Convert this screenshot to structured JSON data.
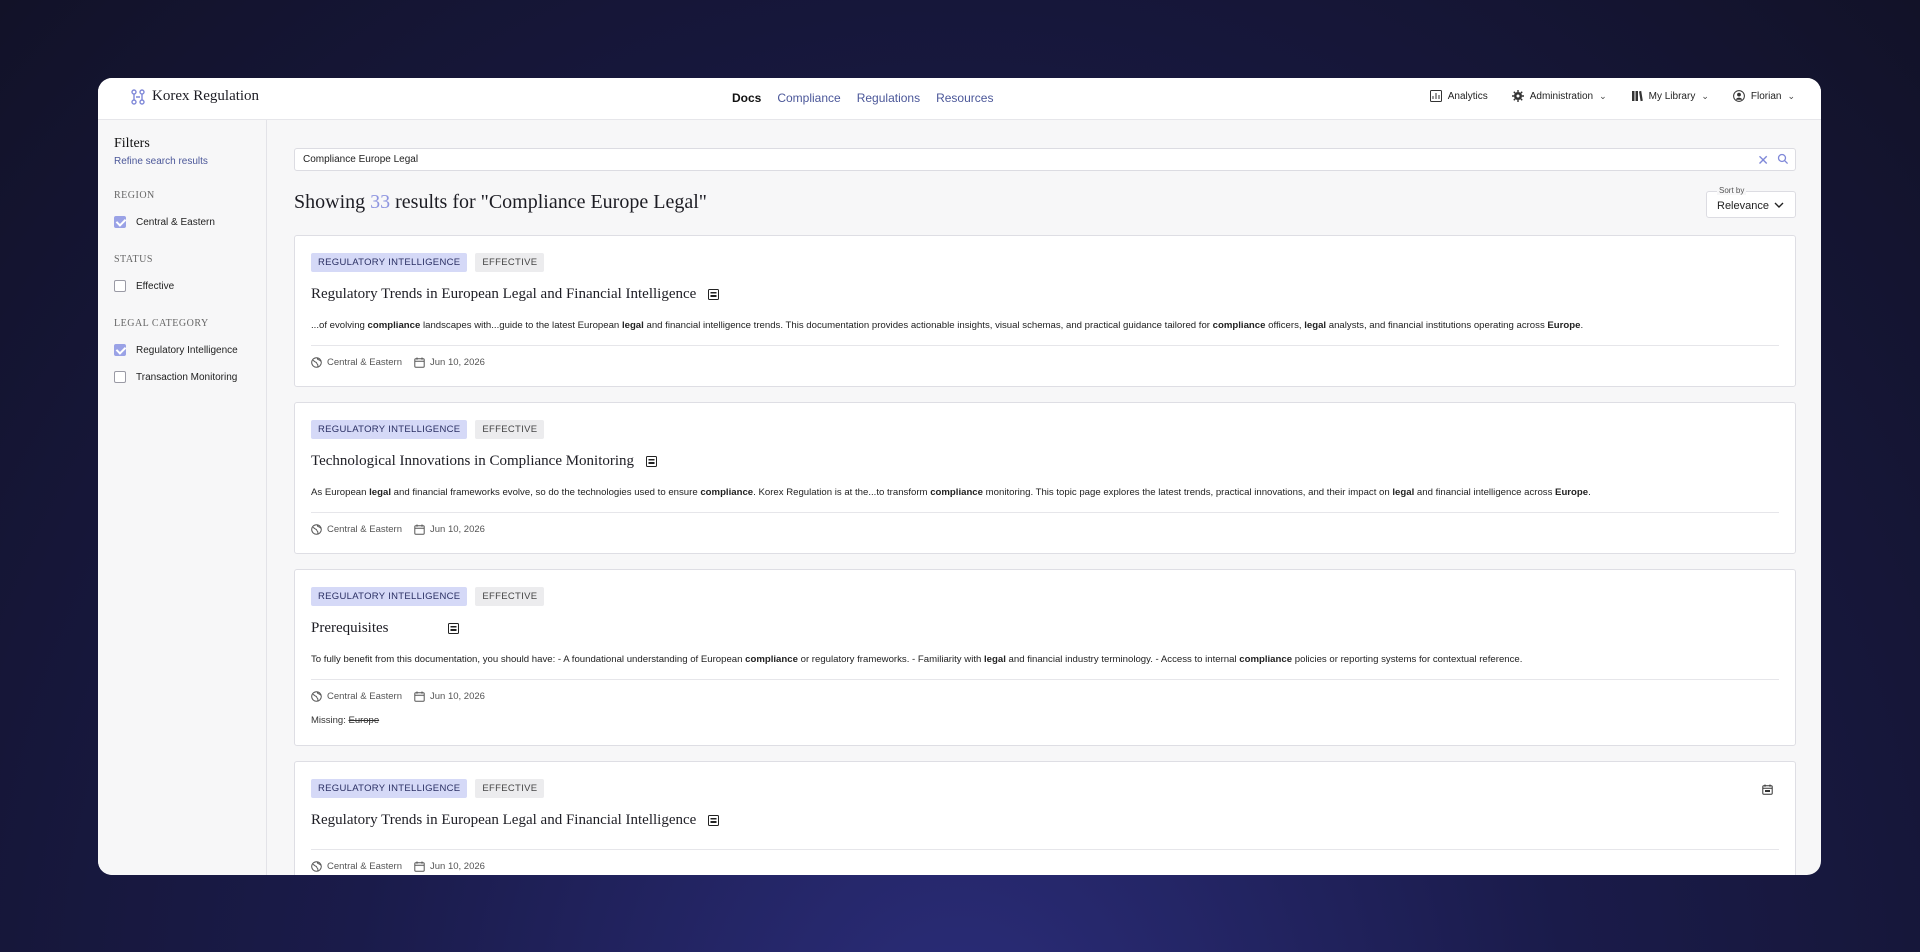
{
  "brand": {
    "name": "Korex Regulation"
  },
  "nav": {
    "links": [
      "Docs",
      "Compliance",
      "Regulations",
      "Resources"
    ],
    "right": {
      "analytics": "Analytics",
      "administration": "Administration",
      "library": "My Library",
      "user": "Florian"
    }
  },
  "sidebar": {
    "title": "Filters",
    "subtitle": "Refine search results",
    "groups": [
      {
        "label": "REGION",
        "options": [
          {
            "label": "Central & Eastern",
            "checked": true
          }
        ]
      },
      {
        "label": "STATUS",
        "options": [
          {
            "label": "Effective",
            "checked": false
          }
        ]
      },
      {
        "label": "LEGAL CATEGORY",
        "options": [
          {
            "label": "Regulatory Intelligence",
            "checked": true
          },
          {
            "label": "Transaction Monitoring",
            "checked": false
          }
        ]
      }
    ]
  },
  "search": {
    "value": "Compliance Europe Legal"
  },
  "results": {
    "prefix": "Showing",
    "count": "33",
    "suffix": "results for \"Compliance Europe Legal\""
  },
  "sort": {
    "label": "Sort by",
    "value": "Relevance"
  },
  "cards": [
    {
      "tag1": "REGULATORY INTELLIGENCE",
      "tag2": "EFFECTIVE",
      "title": "Regulatory Trends in European Legal and Financial Intelligence",
      "region": "Central & Eastern",
      "date": "Jun 10, 2026"
    },
    {
      "tag1": "REGULATORY INTELLIGENCE",
      "tag2": "EFFECTIVE",
      "title": "Technological Innovations in Compliance Monitoring",
      "region": "Central & Eastern",
      "date": "Jun 10, 2026"
    },
    {
      "tag1": "REGULATORY INTELLIGENCE",
      "tag2": "EFFECTIVE",
      "title": "Prerequisites",
      "region": "Central & Eastern",
      "date": "Jun 10, 2026",
      "missing_label": "Missing:",
      "missing_term": "Europe"
    },
    {
      "tag1": "REGULATORY INTELLIGENCE",
      "tag2": "EFFECTIVE",
      "title": "Regulatory Trends in European Legal and Financial Intelligence",
      "region": "Central & Eastern",
      "date": "Jun 10, 2026"
    }
  ],
  "snippets": {
    "c1": [
      "...of evolving ",
      "compliance",
      " landscapes with...guide to the latest European ",
      "legal",
      " and financial intelligence trends. This documentation provides actionable insights, visual schemas, and practical guidance tailored for ",
      "compliance",
      " officers, ",
      "legal",
      " analysts, and financial institutions operating across ",
      "Europe",
      "."
    ],
    "c2": [
      "As European ",
      "legal",
      " and financial frameworks evolve, so do the technologies used to ensure ",
      "compliance",
      ". Korex Regulation is at the...to transform ",
      "compliance",
      " monitoring. This topic page explores the latest trends, practical innovations, and their impact on ",
      "legal",
      " and financial intelligence across ",
      "Europe",
      "."
    ],
    "c3": [
      "To fully benefit from this documentation, you should have: - A foundational understanding of European ",
      "compliance",
      " or regulatory frameworks. - Familiarity with ",
      "legal",
      " and financial industry terminology. - Access to internal ",
      "compliance",
      " policies or reporting systems for contextual reference."
    ]
  },
  "colors": {
    "accent": "#8e95e0",
    "link": "#4b5799",
    "tag_bg": "#d5d9f7"
  }
}
